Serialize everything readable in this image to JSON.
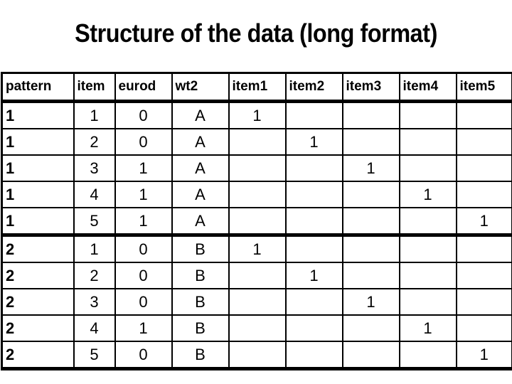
{
  "title": "Structure of the data (long format)",
  "table": {
    "headers": [
      "pattern",
      "item",
      "eurod",
      "wt2",
      "item1",
      "item2",
      "item3",
      "item4",
      "item5"
    ],
    "rows": [
      [
        "1",
        "1",
        "0",
        "A",
        "1",
        "",
        "",
        "",
        ""
      ],
      [
        "1",
        "2",
        "0",
        "A",
        "",
        "1",
        "",
        "",
        ""
      ],
      [
        "1",
        "3",
        "1",
        "A",
        "",
        "",
        "1",
        "",
        ""
      ],
      [
        "1",
        "4",
        "1",
        "A",
        "",
        "",
        "",
        "1",
        ""
      ],
      [
        "1",
        "5",
        "1",
        "A",
        "",
        "",
        "",
        "",
        "1"
      ],
      [
        "2",
        "1",
        "0",
        "B",
        "1",
        "",
        "",
        "",
        ""
      ],
      [
        "2",
        "2",
        "0",
        "B",
        "",
        "1",
        "",
        "",
        ""
      ],
      [
        "2",
        "3",
        "0",
        "B",
        "",
        "",
        "1",
        "",
        ""
      ],
      [
        "2",
        "4",
        "1",
        "B",
        "",
        "",
        "",
        "1",
        ""
      ],
      [
        "2",
        "5",
        "0",
        "B",
        "",
        "",
        "",
        "",
        "1"
      ]
    ]
  }
}
